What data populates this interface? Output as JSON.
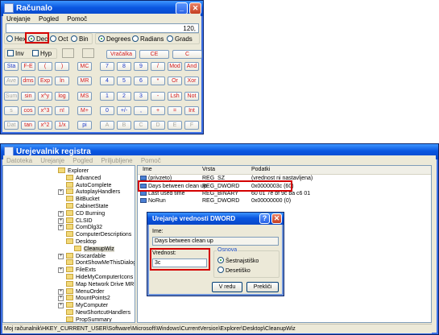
{
  "calculator": {
    "title": "Računalo",
    "menu": [
      "Urejanje",
      "Pogled",
      "Pomoč"
    ],
    "display": "120,",
    "bases": [
      "Hex",
      "Dec",
      "Oct",
      "Bin"
    ],
    "selected_base": "Dec",
    "angles": [
      "Degrees",
      "Radians",
      "Grads"
    ],
    "selected_angle": "Degrees",
    "checkboxes": [
      "Inv",
      "Hyp"
    ],
    "edit_buttons": [
      "Vračalka",
      "CE",
      "C"
    ],
    "rows": [
      [
        "Sta",
        "F-E",
        "(",
        ")",
        "MC",
        "7",
        "8",
        "9",
        "/",
        "Mod",
        "And"
      ],
      [
        "Ave",
        "dms",
        "Exp",
        "ln",
        "MR",
        "4",
        "5",
        "6",
        "*",
        "Or",
        "Xor"
      ],
      [
        "Sum",
        "sin",
        "x^y",
        "log",
        "MS",
        "1",
        "2",
        "3",
        "-",
        "Lsh",
        "Not"
      ],
      [
        "s",
        "cos",
        "x^3",
        "n!",
        "M+",
        "0",
        "+/-",
        ",",
        "+",
        "=",
        "Int"
      ],
      [
        "Dat",
        "tan",
        "x^2",
        "1/x",
        "pi",
        "A",
        "B",
        "C",
        "D",
        "E",
        "F"
      ]
    ]
  },
  "regedit": {
    "title": "Urejevalnik registra",
    "menu": [
      "Datoteka",
      "Urejanje",
      "Pogled",
      "Priljubljene",
      "Pomoč"
    ],
    "tree": [
      "Explorer",
      "Advanced",
      "AutoComplete",
      "AutoplayHandlers",
      "BitBucket",
      "CabinetState",
      "CD Burning",
      "CLSID",
      "ComDlg32",
      "ComputerDescriptions",
      "Desktop",
      "CleanupWiz",
      "Discardable",
      "DontShowMeThisDialog",
      "FileExts",
      "HideMyComputerIcons",
      "Map Network Drive MRU",
      "MenuOrder",
      "MountPoints2",
      "MyComputer",
      "NewShortcutHandlers",
      "PropSummary"
    ],
    "columns": [
      "Ime",
      "Vrsta",
      "Podatki"
    ],
    "values": [
      {
        "name": "(privzeto)",
        "type": "REG_SZ",
        "data": "(vrednost ni nastavljena)"
      },
      {
        "name": "Days between clean up",
        "type": "REG_DWORD",
        "data": "0x0000003c (60)"
      },
      {
        "name": "Last used time",
        "type": "REG_BINARY",
        "data": "60 01 7e bf 9c ba c6 01"
      },
      {
        "name": "NoRun",
        "type": "REG_DWORD",
        "data": "0x00000000 (0)"
      }
    ],
    "status_path": "Moj računalnik\\HKEY_CURRENT_USER\\Software\\Microsoft\\Windows\\CurrentVersion\\Explorer\\Desktop\\CleanupWiz"
  },
  "dword_dialog": {
    "title": "Urejanje vrednosti DWORD",
    "name_label": "Ime:",
    "name_value": "Days between clean up",
    "value_label": "Vrednost:",
    "value_value": "3c",
    "base_group_label": "Osnova",
    "base_hex": "Šestnajstiško",
    "base_dec": "Desetiško",
    "selected_base": "Šestnajstiško",
    "ok_label": "V redu",
    "cancel_label": "Prekliči"
  },
  "colors": {
    "highlight_box": "#d40000",
    "titlebar": "#0a56e0",
    "red_keys": "#d21a1a",
    "blue_keys": "#1d3ac8"
  }
}
